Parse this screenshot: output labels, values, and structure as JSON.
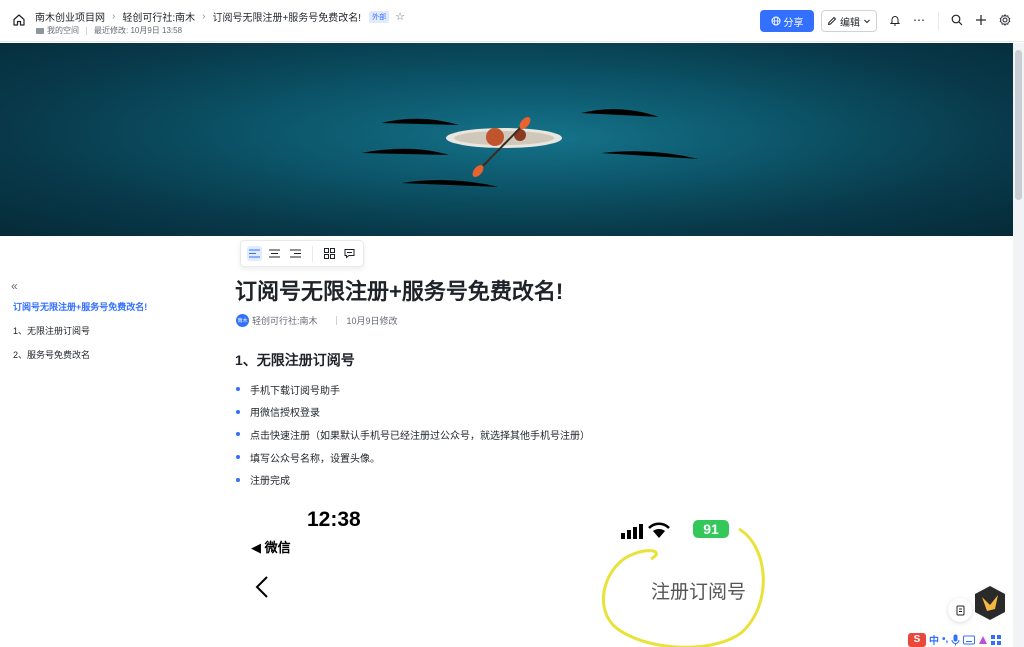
{
  "topbar": {
    "breadcrumbs": [
      "南木创业项目网",
      "轻创可行社:南木",
      "订阅号无限注册+服务号免费改名!"
    ],
    "tag": "外部",
    "meta_location": "我的空间",
    "meta_modified": "最近修改: 10月9日 13:58",
    "share_label": "分享",
    "edit_label": "编辑"
  },
  "outline": {
    "title": "订阅号无限注册+服务号免费改名!",
    "items": [
      "1、无限注册订阅号",
      "2、服务号免费改名"
    ]
  },
  "doc": {
    "title": "订阅号无限注册+服务号免费改名!",
    "author_avatar": "南木",
    "author": "轻创可行社:南木",
    "modified": "10月9日修改",
    "heading1": "1、无限注册订阅号",
    "bullets": [
      "手机下载订阅号助手",
      "用微信授权登录",
      "点击快速注册（如果默认手机号已经注册过公众号，就选择其他手机号注册）",
      "填写公众号名称，设置头像。",
      "注册完成"
    ]
  },
  "phone": {
    "time": "12:38",
    "back_app": "◀ 微信",
    "battery": "91",
    "page_title": "注册订阅号"
  },
  "tray": {
    "ime": "S",
    "ime_mode": "中"
  },
  "colors": {
    "accent": "#3370ff",
    "highlight_circle": "#e8e23a",
    "battery": "#34c759"
  }
}
